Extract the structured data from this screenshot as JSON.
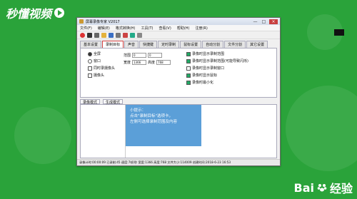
{
  "brand": {
    "name": "秒懂视频"
  },
  "baidu": {
    "text": "Bai",
    "suffix": "经验"
  },
  "window": {
    "title": "屏幕录像专家 V2017",
    "controls": [
      "—",
      "□",
      "×"
    ]
  },
  "menu": [
    "文件(F)",
    "编辑(E)",
    "格式转换(H)",
    "工具(T)",
    "查看(V)",
    "帮助(H)",
    "注册(R)"
  ],
  "tabs": [
    "基本设置",
    "录制目标",
    "声音",
    "快捷键",
    "定时录制",
    "鼠标设置",
    "自动分割",
    "文件分割",
    "其它设置"
  ],
  "panel": {
    "modes": [
      "全屏",
      "窗口",
      "同时录摄像头",
      "摄像头"
    ],
    "mode_selected": 0,
    "fields": {
      "x": "0",
      "w": "1366",
      "y": "0",
      "h": "768"
    },
    "labels": [
      "范围",
      "区域",
      "宽度",
      "高度"
    ],
    "checks": [
      "录像时显示录制范围",
      "录像时显示录制窗口",
      "录像时显示录制范围(可能导致闪烁)",
      "录像时显示录制窗口",
      "录像时显示鼠标",
      "录像时最小化"
    ],
    "highlight": "录像时显示录制范围(可能导致闪烁)"
  },
  "subheader": [
    "录像模式",
    "生成模式"
  ],
  "tip": {
    "title": "小提示：",
    "line1": "点击\"录制目标\"选项卡，",
    "line2": "左侧可选择录制范围及内容"
  },
  "status": "录像计时:00:00:09 已录制:45 速度:7帧/秒 宽度:1366 高度:768 文件大小:114009 创建时间:2018-6-23 16:53"
}
